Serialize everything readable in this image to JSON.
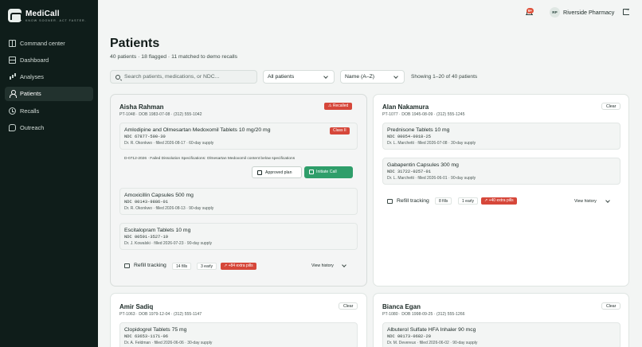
{
  "brand": {
    "name": "MediCall",
    "tagline": "KNOW SOONER. ACT FASTER."
  },
  "nav": [
    {
      "label": "Command center",
      "icon": "grid-icon"
    },
    {
      "label": "Dashboard",
      "icon": "dashboard-icon"
    },
    {
      "label": "Analyses",
      "icon": "bar-chart-icon"
    },
    {
      "label": "Patients",
      "icon": "person-icon",
      "active": true
    },
    {
      "label": "Recalls",
      "icon": "clock-icon"
    },
    {
      "label": "Outreach",
      "icon": "chat-icon"
    }
  ],
  "topbar": {
    "notification_count": "9+",
    "avatar_initials": "RP",
    "user_name": "Riverside Pharmacy"
  },
  "header": {
    "title": "Patients",
    "subtitle": "40 patients · 18 flagged · 11 matched to demo recalls"
  },
  "filters": {
    "search_placeholder": "Search patients, medications, or NDC...",
    "patient_filter": "All patients",
    "sort": "Name (A–Z)",
    "showing": "Showing 1–20 of 40 patients"
  },
  "cards": {
    "aisha": {
      "name": "Aisha Rahman",
      "meta": "PT-1048 · DOB 1983-07-08 · (312) 555-1042",
      "status": "Recalled",
      "rx1": {
        "name": "Amlodipine and Olmesartan Medoxomil Tablets 10 mg/20 mg",
        "ndc": "NDC 67877-500-30",
        "line": "Dr. R. Okonkwo · filled 2026-08-17 · 60-day supply",
        "badge": "Class II"
      },
      "recall_note": "D-0712-2026 · Failed Dissolution Specifications: Olmesartan Medoxomil content below specifications",
      "approved_label": "Approved plan",
      "initiate_label": "Initiate Call",
      "rx2": {
        "name": "Amoxicillin Capsules 500 mg",
        "ndc": "NDC 00143-9886-01",
        "line": "Dr. R. Okonkwo · filled 2026-08-13 · 90-day supply"
      },
      "rx3": {
        "name": "Escitalopram Tablets 10 mg",
        "ndc": "NDC 00591-3527-19",
        "line": "Dr. J. Kowalski · filled 2026-07-23 · 90-day supply"
      },
      "refill": {
        "label": "Refill tracking",
        "fills": "14 fills",
        "early": "3 early",
        "extra": "+84 extra pills",
        "history": "View history"
      }
    },
    "alan": {
      "name": "Alan Nakamura",
      "meta": "PT-1077 · DOB 1945-08-09 · (312) 555-1245",
      "status": "Clear",
      "rx1": {
        "name": "Prednisone Tablets 10 mg",
        "ndc": "NDC 00054-0018-25",
        "line": "Dr. L. Marchetti · filled 2026-07-08 · 30-day supply"
      },
      "rx2": {
        "name": "Gabapentin Capsules 300 mg",
        "ndc": "NDC 31722-0257-01",
        "line": "Dr. L. Marchetti · filled 2026-06-01 · 90-day supply"
      },
      "refill": {
        "label": "Refill tracking",
        "fills": "8 fills",
        "early": "1 early",
        "extra": "+40 extra pills",
        "history": "View history"
      }
    },
    "amir": {
      "name": "Amir Sadiq",
      "meta": "PT-1063 · DOB 1979-12-04 · (312) 555-1147",
      "status": "Clear",
      "rx1": {
        "name": "Clopidogrel Tablets 75 mg",
        "ndc": "NDC 63653-1171-06",
        "line": "Dr. A. Feldman · filled 2026-06-06 · 30-day supply"
      }
    },
    "bianca": {
      "name": "Bianca Egan",
      "meta": "PT-1080 · DOB 1998-09-25 · (312) 555-1266",
      "status": "Clear",
      "rx1": {
        "name": "Albuterol Sulfate HFA Inhaler 90 mcg",
        "ndc": "NDC 00173-0682-20",
        "line": "Dr. M. Devereux · filled 2026-06-02 · 90-day supply"
      }
    }
  },
  "colors": {
    "sidebar": "#0f1d1a",
    "recalled": "#d6473a",
    "accent": "#2f9e6a"
  }
}
